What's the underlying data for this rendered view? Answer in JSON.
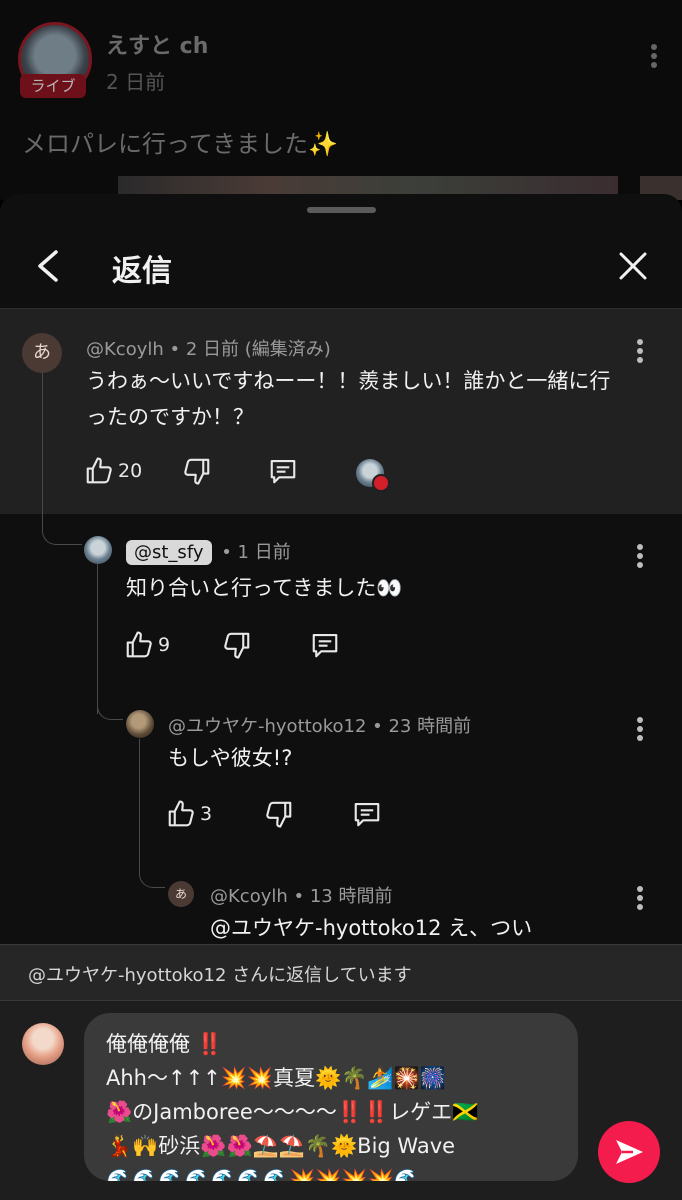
{
  "background_post": {
    "channel_name": "えすと ch",
    "posted_ago": "2 日前",
    "live_badge": "ライブ",
    "text": "メロパレに行ってきました✨"
  },
  "sheet": {
    "title": "返信"
  },
  "comments": [
    {
      "author": "@Kcoylh",
      "meta": " • 2 日前 (編集済み)",
      "avatar_letter": "あ",
      "text": "うわぁ〜いいですねーー！！羨ましい！誰かと一緒に行ったのですか！？",
      "likes": "20"
    },
    {
      "author_chip": "@st_sfy",
      "meta": " • 1 日前",
      "text": "知り合いと行ってきました👀",
      "likes": "9"
    },
    {
      "author": "@ユウヤケ-hyottoko12",
      "meta": " • 23 時間前",
      "text": "もしや彼女!?",
      "likes": "3"
    },
    {
      "author": "@Kcoylh",
      "meta": " • 13 時間前",
      "avatar_letter": "あ",
      "text": "@ユウヤケ-hyottoko12 え、つい"
    }
  ],
  "reply_banner": "@ユウヤケ-hyottoko12 さんに返信しています",
  "composer": {
    "text": "俺俺俺俺 ‼️\nAhh〜↑↑↑💥💥真夏🌞🌴🏄🎇🎆\n🌺のJamboree〜〜〜〜‼️‼️レゲエ🇯🇲\n💃🙌砂浜🌺🌺⛱️⛱️🌴🌞Big Wave\n🌊🌊🌊🌊🌊🌊🌊💥💥💥💥🌊"
  },
  "colors": {
    "accent_send": "#f41c4c",
    "heart": "#d31f2a",
    "sheet_bg": "#0f0f0f",
    "parent_comment_bg": "#212121"
  },
  "icons": [
    "chevron-left-icon",
    "close-icon",
    "thumb-up-icon",
    "thumb-down-icon",
    "reply-icon",
    "more-vert-icon",
    "heart-icon",
    "send-icon"
  ]
}
